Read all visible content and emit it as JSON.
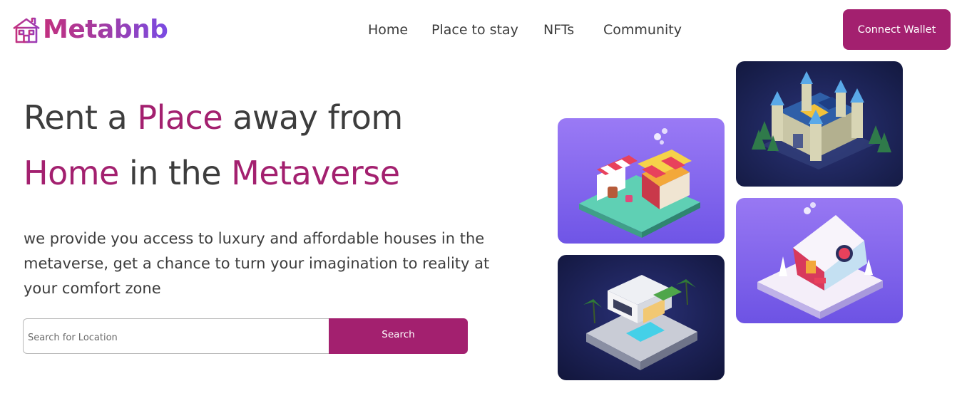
{
  "header": {
    "logo_text": "Metabnb",
    "logo_icon": "house-icon",
    "nav": [
      {
        "label": "Home"
      },
      {
        "label": "Place to stay"
      },
      {
        "label": "NFTs"
      },
      {
        "label": "Community"
      }
    ],
    "connect_label": "Connect Wallet"
  },
  "hero": {
    "line1_start": "Rent a ",
    "line1_accent": "Place",
    "line1_end": " away from",
    "line2_accent1": "Home",
    "line2_mid": " in the ",
    "line2_accent2": "Metaverse",
    "lead": "we provide you access to luxury and affordable houses in the metaverse, get a chance to turn your imagination to reality at your comfort zone"
  },
  "search": {
    "placeholder": "Search for Location",
    "value": "",
    "button_label": "Search"
  },
  "gallery": {
    "tiles": [
      {
        "subject": "isometric-market-stall",
        "bg": "#8a6cf0"
      },
      {
        "subject": "isometric-castle",
        "bg": "#1c2253"
      },
      {
        "subject": "isometric-snow-cottage",
        "bg": "#8566ee"
      },
      {
        "subject": "isometric-modern-villa",
        "bg": "#1a1f4d"
      }
    ]
  },
  "colors": {
    "brand": "#a3206f",
    "text": "#3d3d3d",
    "logo_gradient_start": "#c2307f",
    "logo_gradient_end": "#7a4be3"
  }
}
